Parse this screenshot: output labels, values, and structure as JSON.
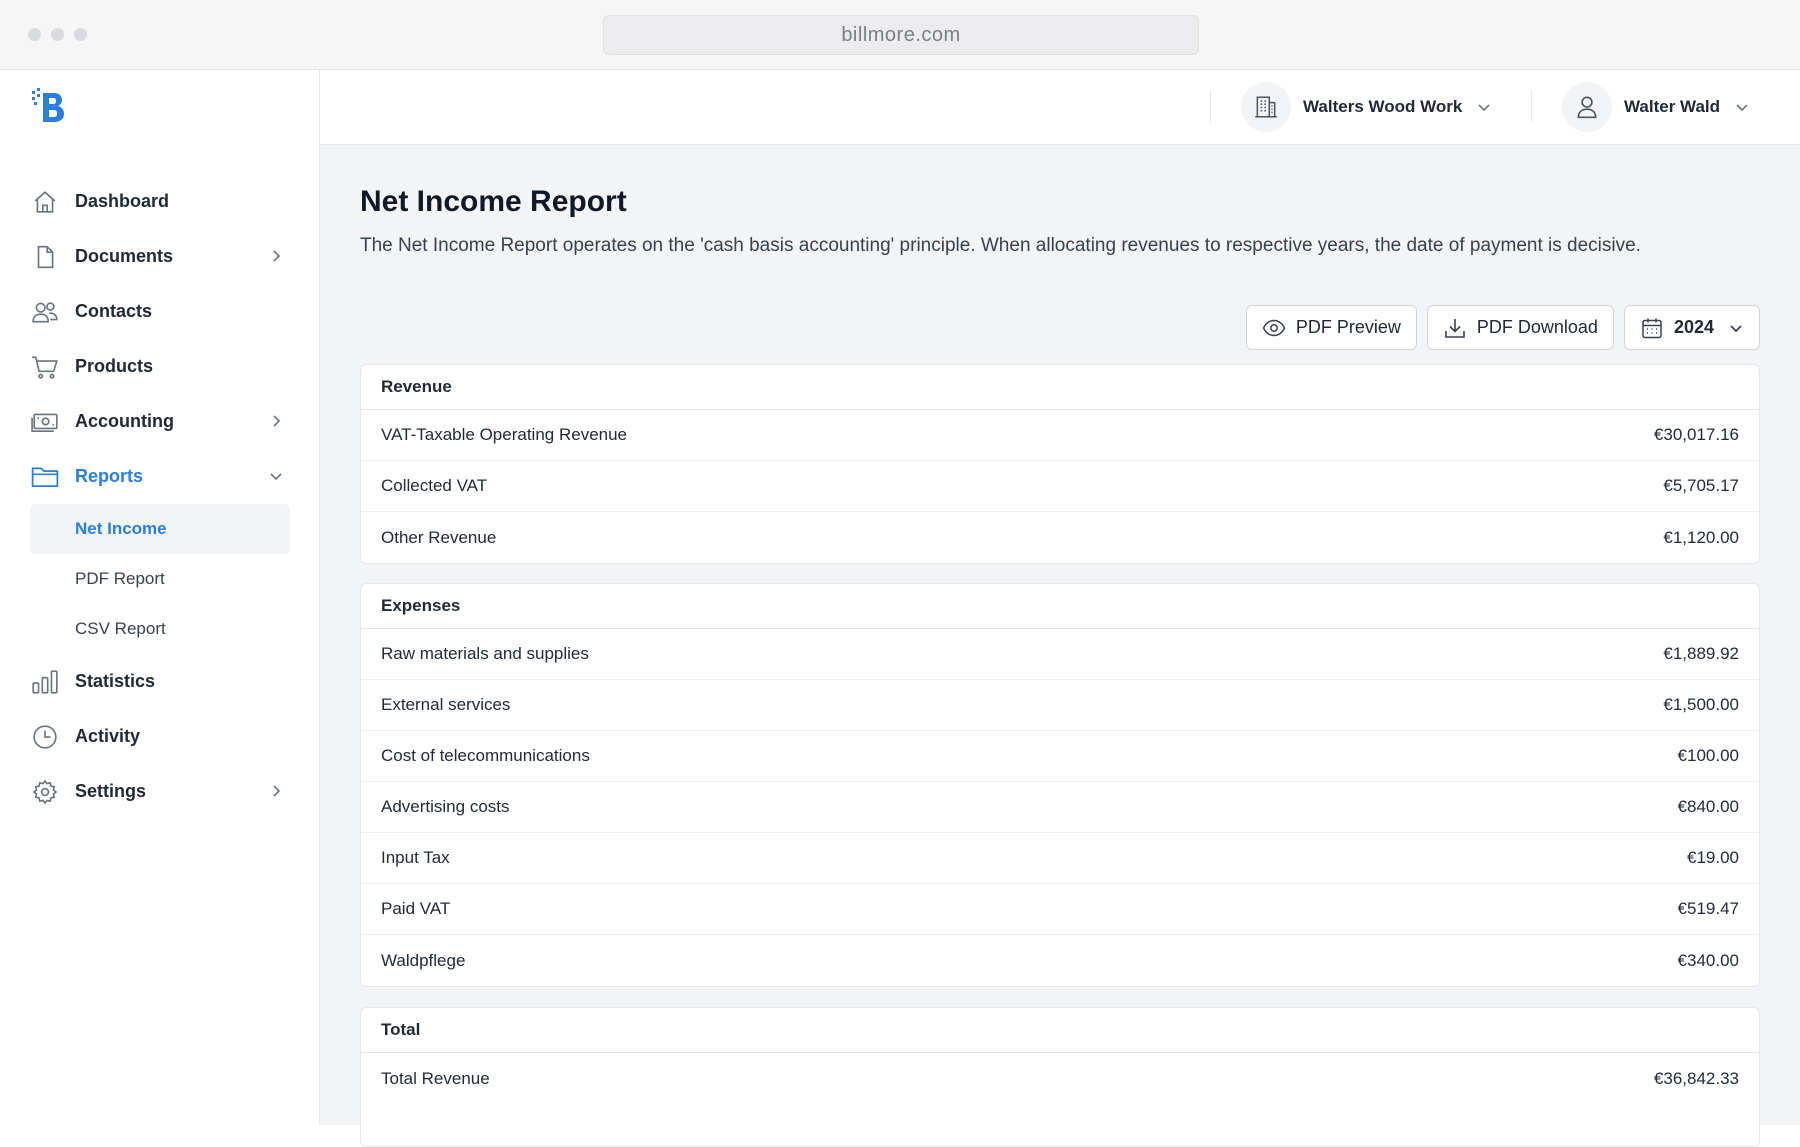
{
  "browser": {
    "url": "billmore.com"
  },
  "sidebar": {
    "items": [
      {
        "label": "Dashboard",
        "icon": "home-icon"
      },
      {
        "label": "Documents",
        "icon": "document-icon"
      },
      {
        "label": "Contacts",
        "icon": "users-icon"
      },
      {
        "label": "Products",
        "icon": "cart-icon"
      },
      {
        "label": "Accounting",
        "icon": "banknote-icon"
      },
      {
        "label": "Reports",
        "icon": "folder-icon"
      },
      {
        "label": "Statistics",
        "icon": "bar-chart-icon"
      },
      {
        "label": "Activity",
        "icon": "clock-icon"
      },
      {
        "label": "Settings",
        "icon": "gear-icon"
      }
    ],
    "reports_sub": [
      {
        "label": "Net Income"
      },
      {
        "label": "PDF Report"
      },
      {
        "label": "CSV Report"
      }
    ],
    "accent": "#2a7de1"
  },
  "header": {
    "company": "Walters Wood Work",
    "user": "Walter Wald"
  },
  "main": {
    "title": "Net Income Report",
    "description": "The Net Income Report operates on the 'cash basis accounting' principle. When allocating revenues to respective years, the date of payment is decisive.",
    "actions": {
      "preview": "PDF Preview",
      "download": "PDF Download",
      "year": "2024"
    },
    "revenue": {
      "heading": "Revenue",
      "rows": [
        {
          "label": "VAT-Taxable Operating Revenue",
          "amount": "€30,017.16"
        },
        {
          "label": "Collected VAT",
          "amount": "€5,705.17"
        },
        {
          "label": "Other Revenue",
          "amount": "€1,120.00"
        }
      ]
    },
    "expenses": {
      "heading": "Expenses",
      "rows": [
        {
          "label": "Raw materials and supplies",
          "amount": "€1,889.92"
        },
        {
          "label": "External services",
          "amount": "€1,500.00"
        },
        {
          "label": "Cost of telecommunications",
          "amount": "€100.00"
        },
        {
          "label": "Advertising costs",
          "amount": "€840.00"
        },
        {
          "label": "Input Tax",
          "amount": "€19.00"
        },
        {
          "label": "Paid VAT",
          "amount": "€519.47"
        },
        {
          "label": "Waldpflege",
          "amount": "€340.00"
        }
      ]
    },
    "total": {
      "heading": "Total",
      "rows": [
        {
          "label": "Total Revenue",
          "amount": "€36,842.33"
        }
      ]
    }
  }
}
